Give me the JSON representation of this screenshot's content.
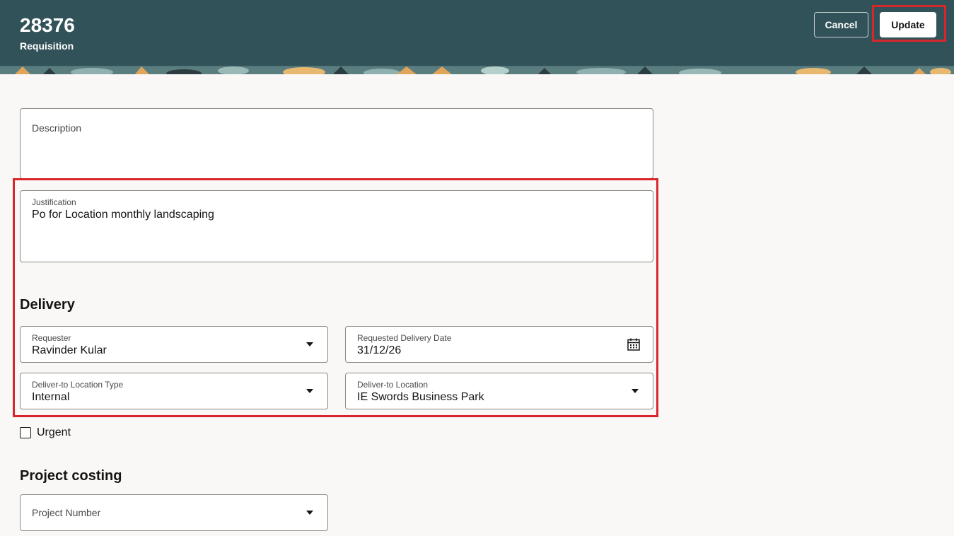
{
  "header": {
    "record_number": "28376",
    "record_type": "Requisition",
    "cancel_label": "Cancel",
    "update_label": "Update"
  },
  "form": {
    "description": {
      "label": "Description",
      "value": ""
    },
    "justification": {
      "label": "Justification",
      "value": "Po for Location monthly landscaping"
    }
  },
  "delivery": {
    "title": "Delivery",
    "requester": {
      "label": "Requester",
      "value": "Ravinder Kular"
    },
    "requested_delivery_date": {
      "label": "Requested Delivery Date",
      "value": "31/12/26"
    },
    "deliver_to_location_type": {
      "label": "Deliver-to Location Type",
      "value": "Internal"
    },
    "deliver_to_location": {
      "label": "Deliver-to Location",
      "value": "IE Swords Business Park"
    },
    "urgent": {
      "label": "Urgent",
      "checked": false
    }
  },
  "project_costing": {
    "title": "Project costing",
    "project_number": {
      "label": "Project Number",
      "value": ""
    }
  },
  "icons": {
    "calendar": "calendar-icon",
    "dropdown": "chevron-down-icon"
  },
  "colors": {
    "header_bg": "#32525a",
    "page_bg": "#f9f8f6",
    "highlight": "#d9262b"
  }
}
